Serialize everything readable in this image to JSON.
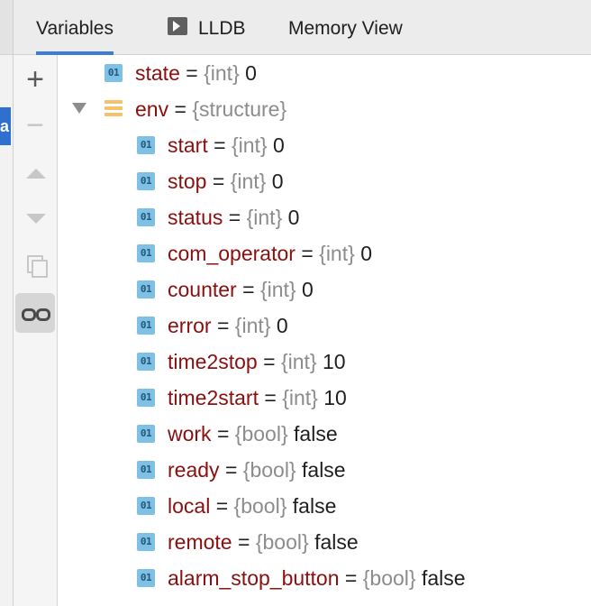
{
  "tabs": [
    {
      "label": "Variables",
      "active": true
    },
    {
      "label": "LLDB",
      "icon": "console-play-icon"
    },
    {
      "label": "Memory View"
    }
  ],
  "outer_gutter_label": "a",
  "toolbar": {
    "items": [
      "plus-icon",
      "minus-icon",
      "arrow-up-icon",
      "arrow-down-icon",
      "copy-icon",
      "glasses-icon"
    ]
  },
  "equals": "=",
  "variables": [
    {
      "name": "state",
      "type": "{int}",
      "value": "0",
      "depth": 0,
      "kind": "scalar"
    },
    {
      "name": "env",
      "type": "{structure}",
      "value": "",
      "depth": 0,
      "kind": "struct",
      "expanded": true
    },
    {
      "name": "start",
      "type": "{int}",
      "value": "0",
      "depth": 1,
      "kind": "scalar"
    },
    {
      "name": "stop",
      "type": "{int}",
      "value": "0",
      "depth": 1,
      "kind": "scalar"
    },
    {
      "name": "status",
      "type": "{int}",
      "value": "0",
      "depth": 1,
      "kind": "scalar"
    },
    {
      "name": "com_operator",
      "type": "{int}",
      "value": "0",
      "depth": 1,
      "kind": "scalar"
    },
    {
      "name": "counter",
      "type": "{int}",
      "value": "0",
      "depth": 1,
      "kind": "scalar"
    },
    {
      "name": "error",
      "type": "{int}",
      "value": "0",
      "depth": 1,
      "kind": "scalar"
    },
    {
      "name": "time2stop",
      "type": "{int}",
      "value": "10",
      "depth": 1,
      "kind": "scalar"
    },
    {
      "name": "time2start",
      "type": "{int}",
      "value": "10",
      "depth": 1,
      "kind": "scalar"
    },
    {
      "name": "work",
      "type": "{bool}",
      "value": "false",
      "depth": 1,
      "kind": "scalar"
    },
    {
      "name": "ready",
      "type": "{bool}",
      "value": "false",
      "depth": 1,
      "kind": "scalar"
    },
    {
      "name": "local",
      "type": "{bool}",
      "value": "false",
      "depth": 1,
      "kind": "scalar"
    },
    {
      "name": "remote",
      "type": "{bool}",
      "value": "false",
      "depth": 1,
      "kind": "scalar"
    },
    {
      "name": "alarm_stop_button",
      "type": "{bool}",
      "value": "false",
      "depth": 1,
      "kind": "scalar"
    }
  ],
  "badge_text": "01",
  "colors": {
    "name": "#8a0f0f",
    "type": "#8c8c8c",
    "value": "#1f1f1f",
    "badge": "#7ec0e6",
    "struct_icon": "#f4c26b",
    "active_tab_underline": "#3d7dd9"
  }
}
